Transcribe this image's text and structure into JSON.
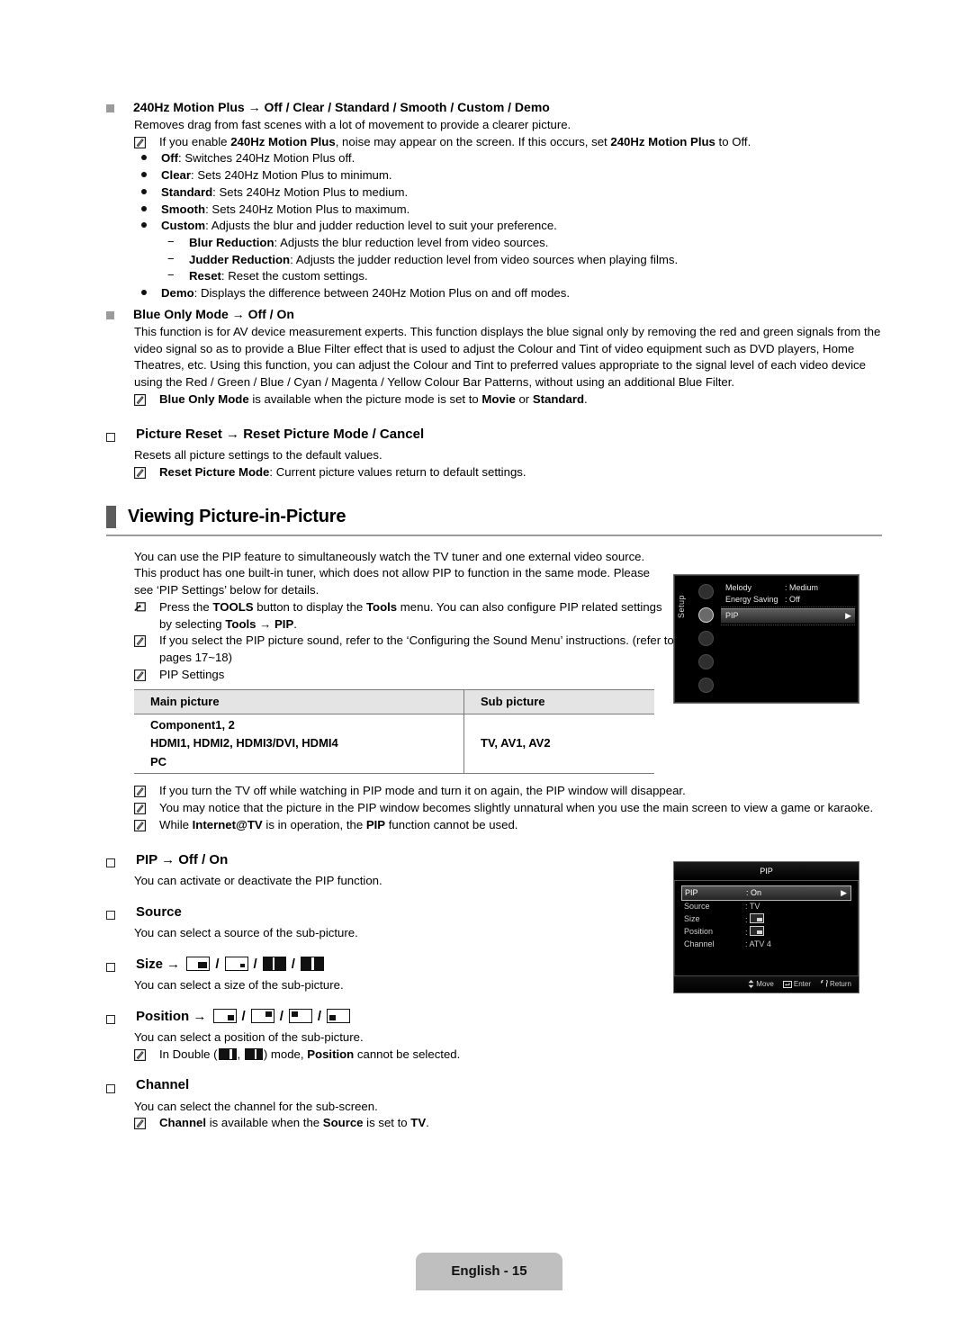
{
  "page": {
    "footer_label": "English - 15"
  },
  "motion_plus": {
    "heading": "240Hz Motion Plus → Off / Clear / Standard / Smooth / Custom / Demo",
    "intro": "Removes drag from fast scenes with a lot of movement to provide a clearer picture.",
    "note": {
      "pre": "If you enable ",
      "bold1": "240Hz Motion Plus",
      "mid": ", noise may appear on the screen. If this occurs, set ",
      "bold2": "240Hz Motion Plus",
      "post": " to Off."
    },
    "options": [
      {
        "term": "Off",
        "desc": ": Switches 240Hz Motion Plus off."
      },
      {
        "term": "Clear",
        "desc": ": Sets 240Hz Motion Plus to minimum."
      },
      {
        "term": "Standard",
        "desc": ": Sets 240Hz Motion Plus to medium."
      },
      {
        "term": "Smooth",
        "desc": ": Sets 240Hz Motion Plus to maximum."
      },
      {
        "term": "Custom",
        "desc": ": Adjusts the blur and judder reduction level to suit your preference."
      }
    ],
    "sub_options": [
      {
        "term": "Blur Reduction",
        "desc": ": Adjusts the blur reduction level from video sources."
      },
      {
        "term": "Judder Reduction",
        "desc": ": Adjusts the judder reduction level from video sources when playing films."
      },
      {
        "term": "Reset",
        "desc": ": Reset the custom settings."
      }
    ],
    "demo": {
      "term": "Demo",
      "desc": ": Displays the difference between 240Hz Motion Plus on and off modes."
    }
  },
  "blue_only": {
    "heading": "Blue Only Mode → Off / On",
    "body": "This function is for AV device measurement experts. This function displays the blue signal only by removing the red and green signals from the video signal so as to provide a Blue Filter effect that is used to adjust the Colour and Tint of video equipment such as DVD players, Home Theatres, etc. Using this function, you can adjust the Colour and Tint to preferred values appropriate to the signal level of each video device using the Red / Green / Blue / Cyan / Magenta / Yellow Colour Bar Patterns, without using an additional Blue Filter.",
    "note": {
      "bold1": "Blue Only Mode",
      "mid": " is available when the picture mode is set to ",
      "bold2": "Movie",
      "mid2": " or ",
      "bold3": "Standard",
      "post": "."
    }
  },
  "picture_reset": {
    "heading": "Picture Reset → Reset Picture Mode / Cancel",
    "body": "Resets all picture settings to the default values.",
    "note": {
      "bold1": "Reset Picture Mode",
      "post": ": Current picture values return to default settings."
    }
  },
  "pip_section": {
    "title": "Viewing Picture-in-Picture",
    "intro": "You can use the PIP feature to simultaneously watch the TV tuner and one external video source. This product has one built-in tuner, which does not allow PIP to function in the same mode. Please see ‘PIP Settings’ below for details.",
    "tools_note": {
      "pre": "Press the ",
      "bold1": "TOOLS",
      "mid": " button to display the ",
      "bold2": "Tools",
      "mid2": " menu. You can also configure PIP related settings by selecting ",
      "bold3": "Tools → PIP",
      "post": "."
    },
    "sound_note": "If you select the PIP picture sound, refer to the ‘Configuring the Sound Menu’ instructions. (refer to pages 17~18)",
    "settings_note": "PIP Settings",
    "table": {
      "headers": [
        "Main picture",
        "Sub picture"
      ],
      "main_rows": [
        "Component1, 2",
        "HDMI1, HDMI2, HDMI3/DVI, HDMI4",
        "PC"
      ],
      "sub_value": "TV, AV1, AV2"
    },
    "notes_after_table": [
      "If you turn the TV off while watching in PIP mode and turn it on again, the PIP window will disappear.",
      "You may notice that the picture in the PIP window becomes slightly unnatural when you use the main screen to view a game or karaoke."
    ],
    "internet_note": {
      "pre": "While ",
      "bold1": "Internet@TV",
      "mid": " is in operation, the ",
      "bold2": "PIP",
      "post": " function cannot be used."
    }
  },
  "pip_items": {
    "pip": {
      "heading": "PIP → Off / On",
      "body": "You can activate or deactivate the PIP function."
    },
    "source": {
      "heading": "Source",
      "body": "You can select a source of the sub-picture."
    },
    "size": {
      "heading_prefix": "Size →",
      "body": "You can select a size of the sub-picture.",
      "icons": [
        "size-large-inset",
        "size-small-inset",
        "size-double-wide",
        "size-double-split"
      ]
    },
    "position": {
      "heading_prefix": "Position →",
      "body": "You can select a position of the sub-picture.",
      "icons": [
        "position-bottom-right",
        "position-top-right",
        "position-top-left",
        "position-bottom-left"
      ],
      "note": {
        "pre": "In Double (",
        "mid": ", ",
        "post": ") mode, ",
        "bold1": "Position",
        "tail": " cannot be selected."
      }
    },
    "channel": {
      "heading": "Channel",
      "body": "You can select the channel for the sub-screen.",
      "note": {
        "bold1": "Channel",
        "mid": " is available when the ",
        "bold2": "Source",
        "mid2": " is set to ",
        "bold3": "TV",
        "post": "."
      }
    }
  },
  "tv_setup_menu": {
    "side_tab": "Setup",
    "rows": [
      {
        "key": "Melody",
        "value": ": Medium"
      },
      {
        "key": "Energy Saving",
        "value": ": Off"
      }
    ],
    "selected_row": {
      "key": "PIP",
      "value": "",
      "arrow": "▶"
    }
  },
  "tv_pip_menu": {
    "title": "PIP",
    "rows": [
      {
        "key": "PIP",
        "value": ": On",
        "selected": true,
        "arrow": "▶"
      },
      {
        "key": "Source",
        "value": ": TV",
        "selected": false
      },
      {
        "key": "Size",
        "value": ":",
        "selected": false,
        "icon": "size-icon"
      },
      {
        "key": "Position",
        "value": ":",
        "selected": false,
        "icon": "position-icon"
      },
      {
        "key": "Channel",
        "value": ": ATV 4",
        "selected": false
      }
    ],
    "footer": [
      {
        "icon": "updown-arrow-icon",
        "label": "Move"
      },
      {
        "icon": "enter-key-icon",
        "label": "Enter"
      },
      {
        "icon": "return-arrow-icon",
        "label": "Return"
      }
    ]
  }
}
